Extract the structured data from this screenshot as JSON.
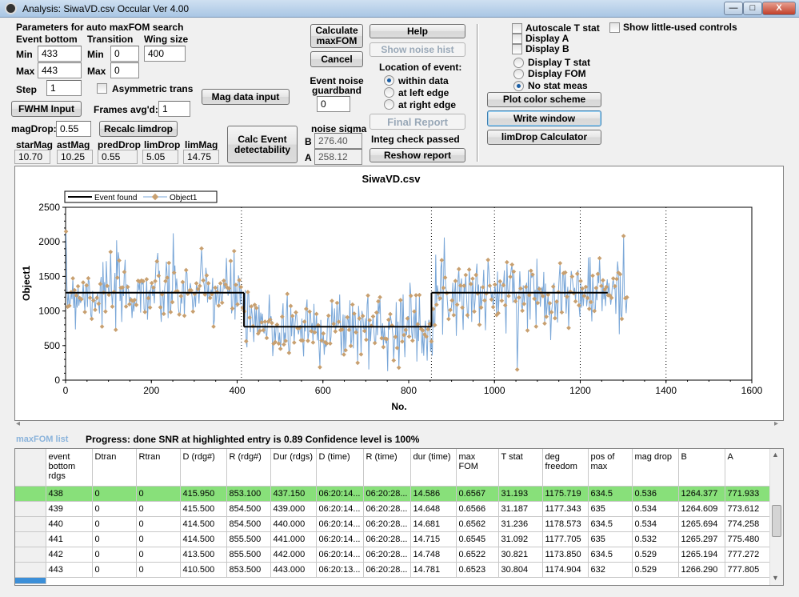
{
  "window": {
    "title": "Analysis: SiwaVD.csv  Occular Ver 4.00",
    "min": "—",
    "max": "□",
    "close": "X"
  },
  "params": {
    "heading": "Parameters for auto maxFOM search",
    "event_bottom": "Event bottom",
    "transition": "Transition",
    "wing_size": "Wing size",
    "min": "Min",
    "max": "Max",
    "step": "Step",
    "min2": "Min",
    "max2": "Max",
    "eb_min": "433",
    "eb_max": "443",
    "step_val": "1",
    "tr_min": "0",
    "tr_max": "0",
    "wing_val": "400",
    "asym": "Asymmetric trans"
  },
  "left": {
    "fwhm": "FWHM Input",
    "frames_label": "Frames avg'd:",
    "frames_val": "1",
    "magdrop_label": "magDrop:",
    "magdrop_val": "0.55",
    "recalc": "Recalc limdrop",
    "mag_input": "Mag data input",
    "calc_event": "Calc Event detectability"
  },
  "mags": {
    "h1": "starMag",
    "h2": "astMag",
    "h3": "predDrop",
    "h4": "limDrop",
    "h5": "limMag",
    "v1": "10.70",
    "v2": "10.25",
    "v3": "0.55",
    "v4": "5.05",
    "v5": "14.75"
  },
  "mid": {
    "calc_maxfom": "Calculate maxFOM",
    "cancel": "Cancel",
    "guard_label": "Event noise guardband",
    "guard_val": "0",
    "noise_sigma": "noise sigma",
    "B": "B",
    "A": "A",
    "sigB": "276.40",
    "sigA": "258.12"
  },
  "right": {
    "help": "Help",
    "show_noise": "Show noise hist",
    "location": "Location of event:",
    "within": "within data",
    "left_edge": "at left edge",
    "right_edge": "at right edge",
    "final_report": "Final Report",
    "integ": "Integ check passed",
    "reshow": "Reshow report"
  },
  "far": {
    "autoscale": "Autoscale T stat",
    "dispA": "Display A",
    "dispB": "Display B",
    "dispT": "Display T stat",
    "dispFOM": "Display FOM",
    "nostat": "No stat meas",
    "show_little": "Show little-used controls",
    "plot_color": "Plot color scheme",
    "write_window": "Write window",
    "limdrop_calc": "limDrop Calculator"
  },
  "chart_data": {
    "type": "line",
    "title": "SiwaVD.csv",
    "xlabel": "No.",
    "ylabel": "Object1",
    "xlim": [
      0,
      1600
    ],
    "ylim": [
      0,
      2500
    ],
    "xticks": [
      "0",
      "200",
      "400",
      "600",
      "800",
      "1000",
      "1200",
      "1400",
      "1600"
    ],
    "yticks": [
      "0",
      "500",
      "1000",
      "1500",
      "2000",
      "2500"
    ],
    "series": [
      {
        "name": "Event found",
        "color": "#000000",
        "segments": [
          {
            "x": [
              1,
              415.95
            ],
            "y": 1264
          },
          {
            "x": 415.95,
            "y": [
              1264,
              772
            ]
          },
          {
            "x": [
              415.95,
              853.1
            ],
            "y": 772
          },
          {
            "x": 853.1,
            "y": [
              772,
              1264
            ]
          },
          {
            "x": [
              853.1,
              1264
            ],
            "y": 1264
          }
        ]
      },
      {
        "name": "Object1",
        "color": "#7aa7d8",
        "marker_color": "#c8a070",
        "n": 1310,
        "baseline_outside": 1264,
        "baseline_inside": 772,
        "noise_sigma": 260
      }
    ],
    "event_markers_x": [
      410,
      853
    ],
    "gridlines_x": [
      1000,
      1200,
      1400
    ]
  },
  "status": {
    "list_label": "maxFOM list",
    "progress": "Progress: done   SNR at highlighted entry is 0.89   Confidence level is   100%"
  },
  "table": {
    "headers": [
      "event bottom rdgs",
      "Dtran",
      "Rtran",
      "D (rdg#)",
      "R (rdg#)",
      "Dur (rdgs)",
      "D (time)",
      "R (time)",
      "dur (time)",
      "max FOM",
      "T stat",
      "deg freedom",
      "pos of max",
      "mag drop",
      "B",
      "A"
    ],
    "rows": [
      [
        "438",
        "0",
        "0",
        "415.950",
        "853.100",
        "437.150",
        "06:20:14...",
        "06:20:28...",
        "14.586",
        "0.6567",
        "31.193",
        "1175.719",
        "634.5",
        "0.536",
        "1264.377",
        "771.933"
      ],
      [
        "439",
        "0",
        "0",
        "415.500",
        "854.500",
        "439.000",
        "06:20:14...",
        "06:20:28...",
        "14.648",
        "0.6566",
        "31.187",
        "1177.343",
        "635",
        "0.534",
        "1264.609",
        "773.612"
      ],
      [
        "440",
        "0",
        "0",
        "414.500",
        "854.500",
        "440.000",
        "06:20:14...",
        "06:20:28...",
        "14.681",
        "0.6562",
        "31.236",
        "1178.573",
        "634.5",
        "0.534",
        "1265.694",
        "774.258"
      ],
      [
        "441",
        "0",
        "0",
        "414.500",
        "855.500",
        "441.000",
        "06:20:14...",
        "06:20:28...",
        "14.715",
        "0.6545",
        "31.092",
        "1177.705",
        "635",
        "0.532",
        "1265.297",
        "775.480"
      ],
      [
        "442",
        "0",
        "0",
        "413.500",
        "855.500",
        "442.000",
        "06:20:14...",
        "06:20:28...",
        "14.748",
        "0.6522",
        "30.821",
        "1173.850",
        "634.5",
        "0.529",
        "1265.194",
        "777.272"
      ],
      [
        "443",
        "0",
        "0",
        "410.500",
        "853.500",
        "443.000",
        "06:20:13...",
        "06:20:28...",
        "14.781",
        "0.6523",
        "30.804",
        "1174.904",
        "632",
        "0.529",
        "1266.290",
        "777.805"
      ]
    ]
  }
}
